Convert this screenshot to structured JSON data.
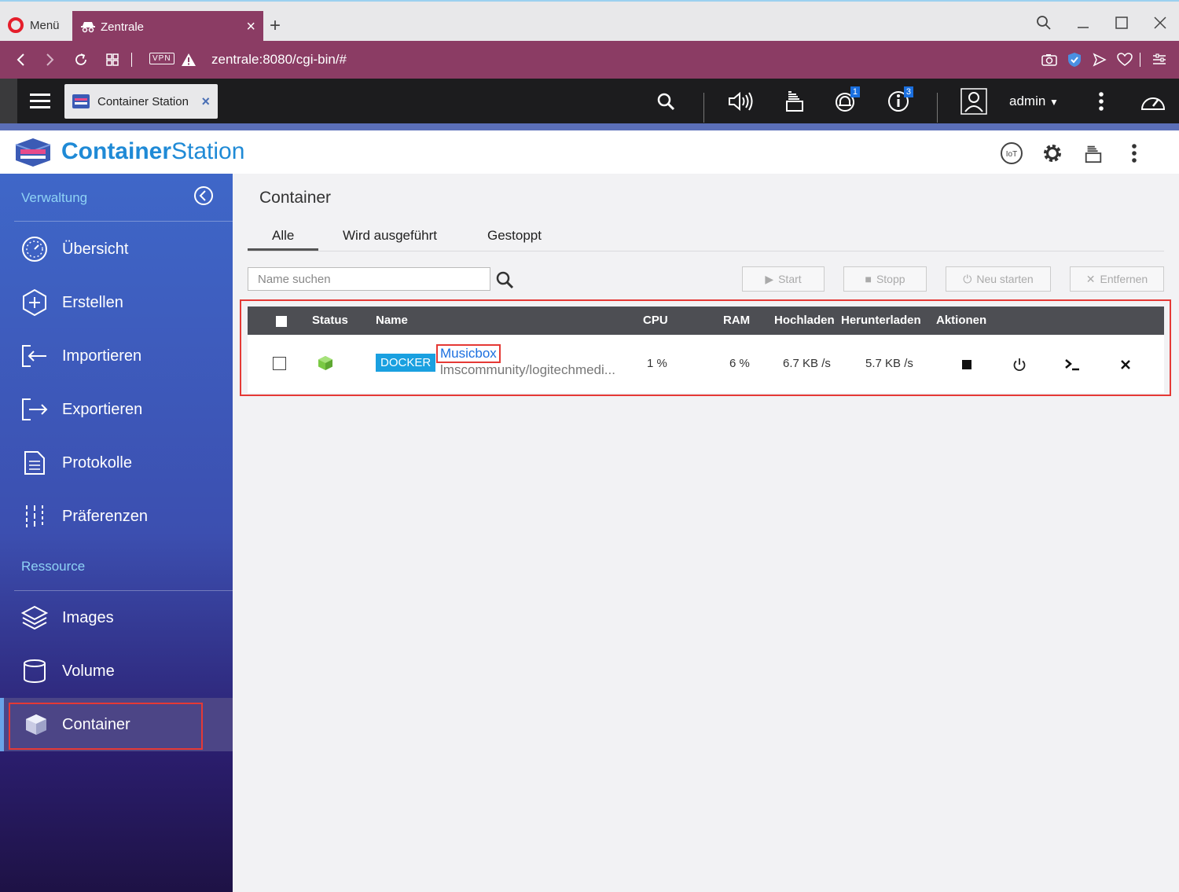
{
  "browser": {
    "menu_label": "Menü",
    "tab_title": "Zentrale",
    "tab_close": "×",
    "new_tab": "+",
    "vpn": "VPN",
    "url": "zentrale:8080/cgi-bin/#"
  },
  "qts": {
    "app_tab_label": "Container Station",
    "app_tab_close": "×",
    "notification_count": "1",
    "info_count": "3",
    "user": "admin"
  },
  "app": {
    "title_bold": "Container",
    "title_rest": "Station"
  },
  "sidebar": {
    "section_manage": "Verwaltung",
    "items": [
      {
        "label": "Übersicht"
      },
      {
        "label": "Erstellen"
      },
      {
        "label": "Importieren"
      },
      {
        "label": "Exportieren"
      },
      {
        "label": "Protokolle"
      },
      {
        "label": "Präferenzen"
      }
    ],
    "section_resource": "Ressource",
    "resource_items": [
      {
        "label": "Images"
      },
      {
        "label": "Volume"
      },
      {
        "label": "Container"
      }
    ]
  },
  "main": {
    "title": "Container",
    "tabs": [
      "Alle",
      "Wird ausgeführt",
      "Gestoppt"
    ],
    "search_placeholder": "Name suchen",
    "buttons": {
      "start": "Start",
      "stop": "Stopp",
      "restart": "Neu starten",
      "remove": "Entfernen"
    },
    "columns": [
      "Status",
      "Name",
      "CPU",
      "RAM",
      "Hochladen",
      "Herunterladen",
      "Aktionen"
    ],
    "rows": [
      {
        "type": "DOCKER",
        "name": "Musicbox",
        "image": "lmscommunity/logitechmedi...",
        "cpu": "1 %",
        "ram": "6 %",
        "upload": "6.7 KB /s",
        "download": "5.7 KB /s"
      }
    ]
  },
  "colors": {
    "browser_bar": "#8b3c64",
    "accent_blue": "#1f8ad6",
    "highlight": "#e53935",
    "docker": "#1aa0e0",
    "status_running": "#7ac943"
  }
}
